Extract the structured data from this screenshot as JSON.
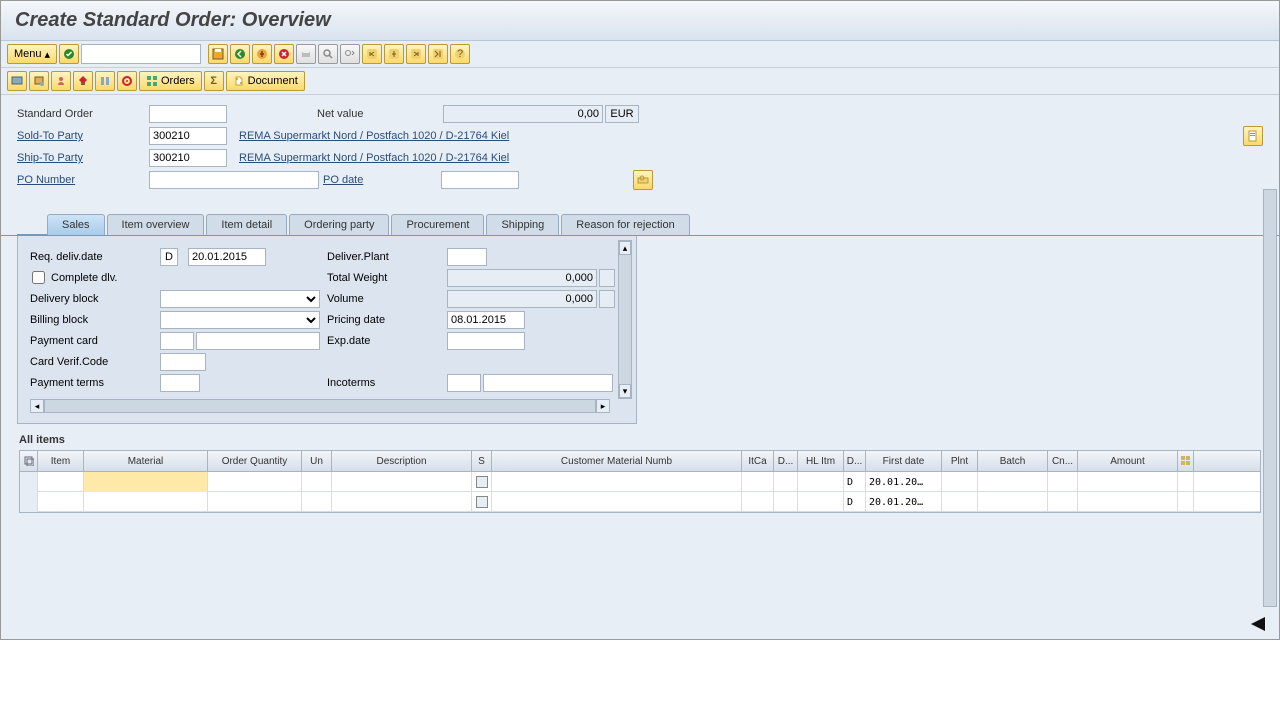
{
  "title": "Create Standard Order: Overview",
  "menu_label": "Menu",
  "orders_btn": "Orders",
  "document_btn": "Document",
  "header": {
    "standard_order_label": "Standard Order",
    "standard_order_value": "",
    "net_value_label": "Net value",
    "net_value": "0,00",
    "currency": "EUR",
    "sold_to_label": "Sold-To Party",
    "sold_to": "300210",
    "sold_to_text": "REMA Supermarkt Nord / Postfach 1020 / D-21764 Kiel",
    "ship_to_label": "Ship-To Party",
    "ship_to": "300210",
    "ship_to_text": "REMA Supermarkt Nord / Postfach 1020 / D-21764 Kiel",
    "po_number_label": "PO Number",
    "po_number": "",
    "po_date_label": "PO date",
    "po_date": ""
  },
  "tabs": [
    "Sales",
    "Item overview",
    "Item detail",
    "Ordering party",
    "Procurement",
    "Shipping",
    "Reason for rejection"
  ],
  "sales": {
    "req_deliv_label": "Req. deliv.date",
    "req_deliv_type": "D",
    "req_deliv_date": "20.01.2015",
    "complete_dlv_label": "Complete dlv.",
    "delivery_block_label": "Delivery block",
    "billing_block_label": "Billing block",
    "payment_card_label": "Payment card",
    "card_verif_label": "Card Verif.Code",
    "payment_terms_label": "Payment terms",
    "deliver_plant_label": "Deliver.Plant",
    "total_weight_label": "Total Weight",
    "total_weight": "0,000",
    "volume_label": "Volume",
    "volume": "0,000",
    "pricing_date_label": "Pricing date",
    "pricing_date": "08.01.2015",
    "exp_date_label": "Exp.date",
    "incoterms_label": "Incoterms"
  },
  "all_items_label": "All items",
  "grid": {
    "cols": [
      "",
      "Item",
      "Material",
      "Order Quantity",
      "Un",
      "Description",
      "S",
      "Customer Material Numb",
      "ItCa",
      "D...",
      "HL Itm",
      "D...",
      "First date",
      "Plnt",
      "Batch",
      "Cn...",
      "Amount",
      ""
    ],
    "rows": [
      {
        "d": "D",
        "first_date": "20.01.20…"
      },
      {
        "d": "D",
        "first_date": "20.01.20…"
      }
    ]
  }
}
